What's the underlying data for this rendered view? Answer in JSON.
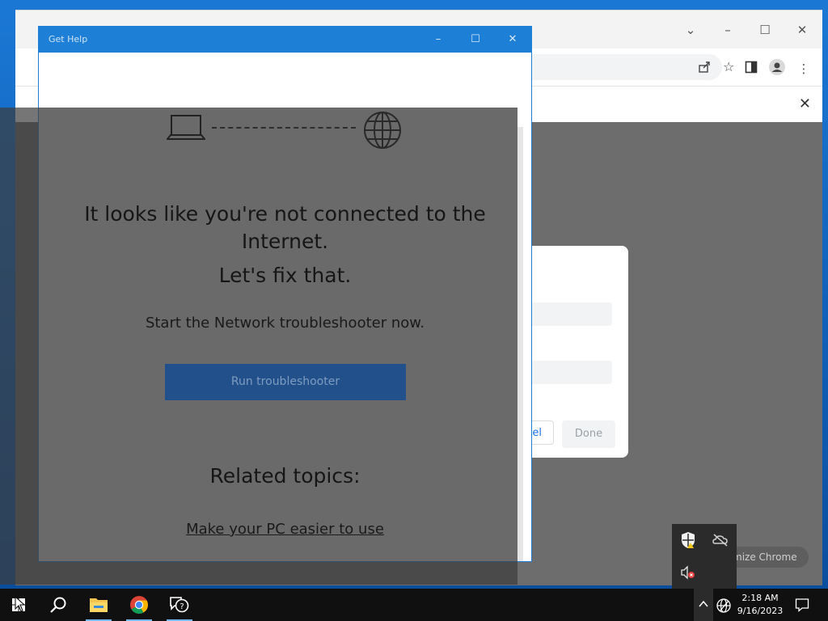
{
  "chrome": {
    "dialog": {
      "cancel_label": "el",
      "done_label": "Done"
    },
    "customize_label": "mize Chrome"
  },
  "gethelp": {
    "window_title": "Get Help",
    "headline_line1": "It looks like you're not connected to the",
    "headline_line2": "Internet.",
    "fix_text": "Let's fix that.",
    "start_text": "Start the Network troubleshooter now.",
    "run_button_label": "Run troubleshooter",
    "related_heading": "Related topics:",
    "related_link": "Make your PC easier to use"
  },
  "taskbar": {
    "time": "2:18 AM",
    "date": "9/16/2023",
    "pinned": [
      "start-button",
      "search",
      "file-explorer",
      "chrome",
      "get-help"
    ]
  },
  "colors": {
    "accent": "#1e7fd6",
    "run_button": "#21508a"
  }
}
